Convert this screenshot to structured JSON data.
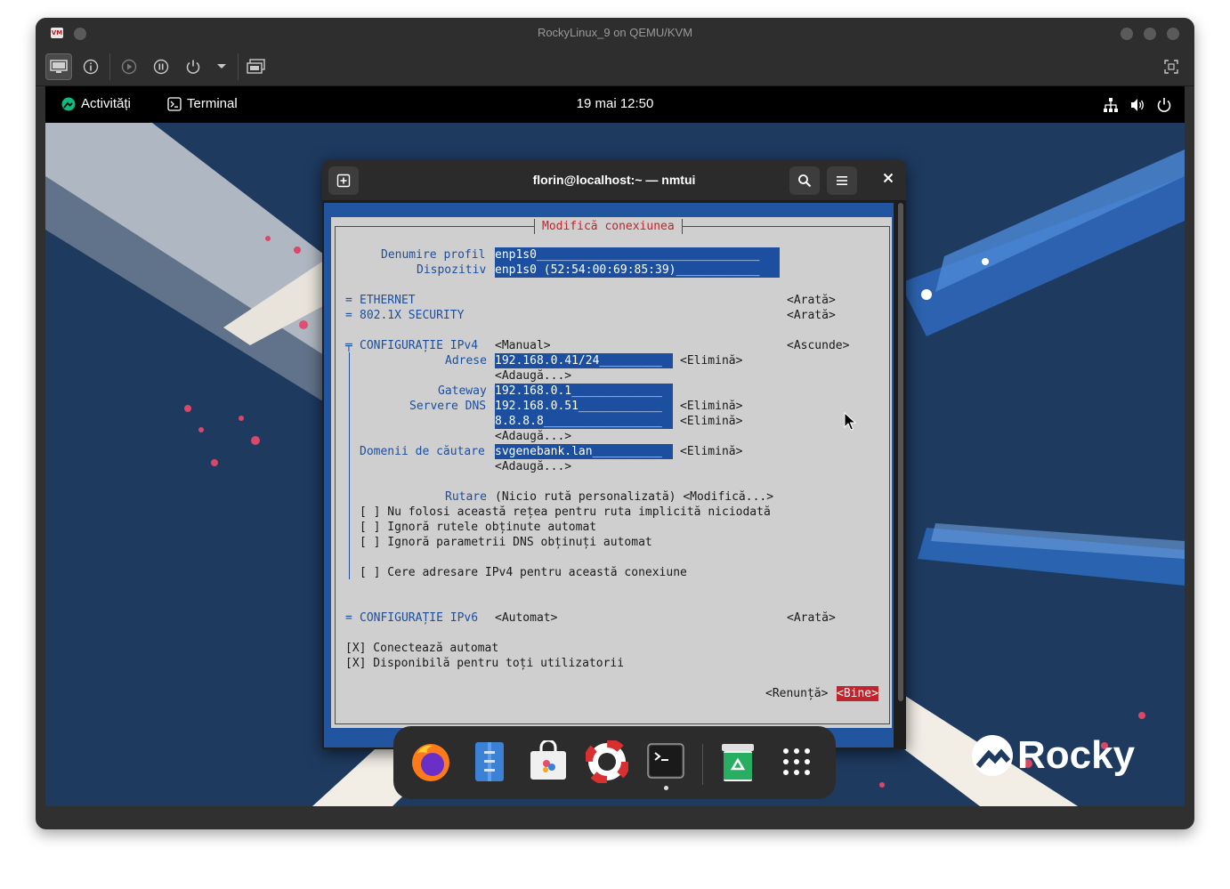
{
  "window": {
    "title": "RockyLinux_9 on QEMU/KVM"
  },
  "toolbar": {
    "items": [
      "console-icon",
      "info-icon",
      "run-icon",
      "pause-icon",
      "shutdown-icon",
      "dropdown-icon",
      "screenshot-icon",
      "fullscreen-icon"
    ]
  },
  "gnome": {
    "activities": "Activități",
    "app_name": "Terminal",
    "clock": "19 mai  12:50"
  },
  "terminal": {
    "title": "florin@localhost:~ — nmtui"
  },
  "dialog": {
    "title": "Modifică conexiunea",
    "profile_name_label": "Denumire profil",
    "profile_name_value": "enp1s0________________________________",
    "device_label": "Dispozitiv",
    "device_value": "enp1s0 (52:54:00:69:85:39)____________",
    "ethernet_label": "ETHERNET",
    "ethernet_toggle": "<Arată>",
    "security_label": "802.1X SECURITY",
    "security_toggle": "<Arată>",
    "ipv4_label": "CONFIGURAȚIE IPv4",
    "ipv4_mode": "<Manual>",
    "ipv4_toggle": "<Ascunde>",
    "addresses_label": "Adrese",
    "address_value": "192.168.0.41/24_________",
    "remove": "<Elimină>",
    "add": "<Adaugă...>",
    "gateway_label": "Gateway",
    "gateway_value": "192.168.0.1_____________",
    "dns_label": "Servere DNS",
    "dns_1": "192.168.0.51____________",
    "dns_2": "8.8.8.8_________________",
    "search_label": "Domenii de căutare",
    "search_value": "svgenebank.lan__________",
    "routing_label": "Rutare",
    "routing_value": "(Nicio rută personalizată) <Modifică...>",
    "opt_never_default": "[ ] Nu folosi această rețea pentru ruta implicită niciodată",
    "opt_ignore_routes": "[ ] Ignoră rutele obținute automat",
    "opt_ignore_dns": "[ ] Ignoră parametrii DNS obținuți automat",
    "opt_require_ipv4": "[ ] Cere adresare IPv4 pentru această conexiune",
    "ipv6_label": "CONFIGURAȚIE IPv6",
    "ipv6_mode": "<Automat>",
    "ipv6_toggle": "<Arată>",
    "autoconnect": "[X] Conectează automat",
    "all_users": "[X] Disponibilă pentru toți utilizatorii",
    "cancel": "<Renunță>",
    "ok": "<Bine>"
  },
  "branding": {
    "logo_text": "Rocky"
  },
  "dock": {
    "items": [
      "firefox-icon",
      "files-icon",
      "software-icon",
      "help-icon",
      "terminal-icon",
      "trash-icon",
      "app-grid-icon"
    ]
  },
  "colors": {
    "tui_blue": "#2255a0",
    "field_blue": "#1c4fa0",
    "accent_red": "#c0242c",
    "wallpaper": "#1e3a5f"
  }
}
